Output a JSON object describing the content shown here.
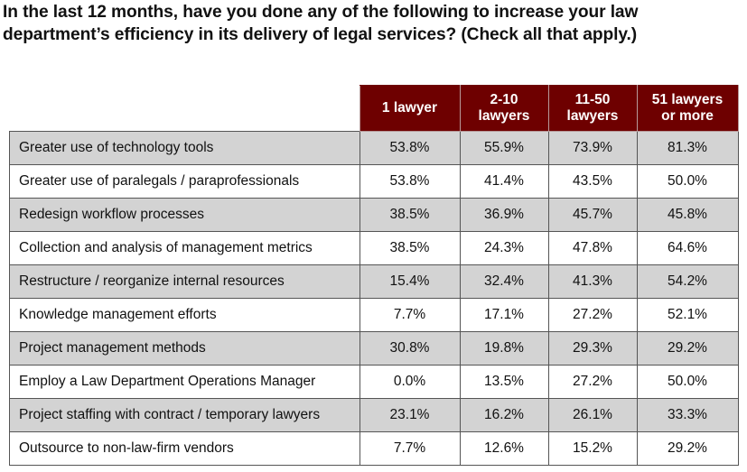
{
  "title": "In the last 12 months, have you done any of the following to increase your law department’s efficiency in its delivery of legal services?  (Check all that apply.)",
  "colors": {
    "header_bg": "#6e0000",
    "header_text": "#ffffff",
    "shaded_row": "#d3d3d3"
  },
  "table": {
    "columns": [
      "1 lawyer",
      "2-10 lawyers",
      "11-50 lawyers",
      "51 lawyers or more"
    ],
    "column_lines": [
      [
        "1 lawyer"
      ],
      [
        "2-10",
        "lawyers"
      ],
      [
        "11-50",
        "lawyers"
      ],
      [
        "51 lawyers",
        "or more"
      ]
    ],
    "rows": [
      {
        "label": "Greater use of technology tools",
        "values": [
          "53.8%",
          "55.9%",
          "73.9%",
          "81.3%"
        ]
      },
      {
        "label": "Greater use of paralegals / paraprofessionals",
        "values": [
          "53.8%",
          "41.4%",
          "43.5%",
          "50.0%"
        ]
      },
      {
        "label": "Redesign workflow processes",
        "values": [
          "38.5%",
          "36.9%",
          "45.7%",
          "45.8%"
        ]
      },
      {
        "label": "Collection and analysis of management metrics",
        "values": [
          "38.5%",
          "24.3%",
          "47.8%",
          "64.6%"
        ]
      },
      {
        "label": "Restructure / reorganize internal resources",
        "values": [
          "15.4%",
          "32.4%",
          "41.3%",
          "54.2%"
        ]
      },
      {
        "label": "Knowledge management efforts",
        "values": [
          "7.7%",
          "17.1%",
          "27.2%",
          "52.1%"
        ]
      },
      {
        "label": "Project management methods",
        "values": [
          "30.8%",
          "19.8%",
          "29.3%",
          "29.2%"
        ]
      },
      {
        "label": "Employ a Law Department Operations Manager",
        "values": [
          "0.0%",
          "13.5%",
          "27.2%",
          "50.0%"
        ]
      },
      {
        "label": "Project staffing with contract / temporary lawyers",
        "values": [
          "23.1%",
          "16.2%",
          "26.1%",
          "33.3%"
        ]
      },
      {
        "label": "Outsource to non-law-firm vendors",
        "values": [
          "7.7%",
          "12.6%",
          "15.2%",
          "29.2%"
        ]
      }
    ]
  }
}
